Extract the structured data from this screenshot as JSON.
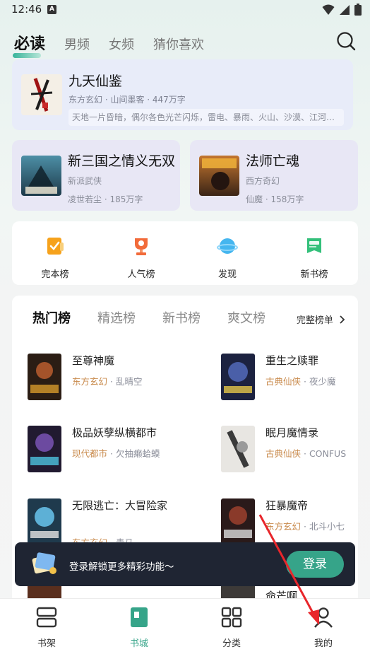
{
  "status": {
    "time": "12:46",
    "notif": "A"
  },
  "top_tabs": [
    {
      "label": "必读",
      "active": true
    },
    {
      "label": "男频"
    },
    {
      "label": "女频"
    },
    {
      "label": "猜你喜欢"
    }
  ],
  "featured": {
    "title": "九天仙鉴",
    "meta": "东方玄幻 · 山间墨客 · 447万字",
    "desc": "天地一片昏暗，偶尔各色光芒闪烁，雷电、暴雨、火山、沙漠、江河…"
  },
  "half_cards": [
    {
      "title": "新三国之情义无双",
      "genre": "新派武侠",
      "meta": "凌世若尘 · 185万字"
    },
    {
      "title": "法师亡魂",
      "genre": "西方奇幻",
      "meta": "仙魔 · 158万字"
    }
  ],
  "quick": [
    {
      "label": "完本榜",
      "icon": "clipboard-check-icon"
    },
    {
      "label": "人气榜",
      "icon": "trophy-icon"
    },
    {
      "label": "发现",
      "icon": "planet-icon"
    },
    {
      "label": "新书榜",
      "icon": "new-flag-icon"
    }
  ],
  "rank": {
    "tabs": [
      {
        "label": "热门榜",
        "active": true
      },
      {
        "label": "精选榜"
      },
      {
        "label": "新书榜"
      },
      {
        "label": "爽文榜"
      }
    ],
    "all_label": "完整榜单"
  },
  "books": [
    {
      "title": "至尊神魔",
      "category": "东方玄幻",
      "author": "乱晴空"
    },
    {
      "title": "重生之赎罪",
      "category": "古典仙侠",
      "author": "夜少魔"
    },
    {
      "title": "极品妖孽纵横都市",
      "category": "现代都市",
      "author": "欠抽癞蛤蟆"
    },
    {
      "title": "眠月魔情录",
      "category": "古典仙侠",
      "author": "CONFUS"
    },
    {
      "title": "无限逃亡：大冒险家",
      "category": "东方玄幻",
      "author": "青马"
    },
    {
      "title": "狂暴魔帝",
      "category": "东方玄幻",
      "author": "北斗小七"
    }
  ],
  "partial_books": [
    "命芒啊"
  ],
  "login": {
    "text": "登录解锁更多精彩功能～",
    "button": "登录"
  },
  "nav": [
    {
      "label": "书架",
      "icon": "bookshelf-icon"
    },
    {
      "label": "书城",
      "icon": "bookstore-icon",
      "active": true
    },
    {
      "label": "分类",
      "icon": "category-grid-icon"
    },
    {
      "label": "我的",
      "icon": "profile-icon"
    }
  ],
  "colors": {
    "accent": "#36a489",
    "category": "#c8894a",
    "banner": "#1f2533",
    "annotation_arrow": "#e8262b"
  }
}
